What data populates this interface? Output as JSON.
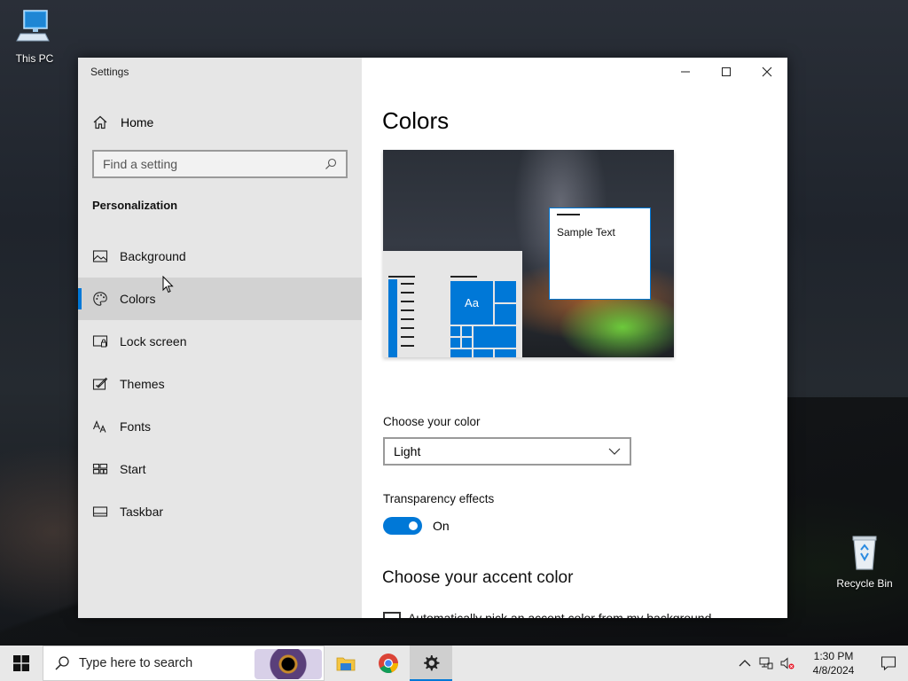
{
  "desktop": {
    "icons": [
      {
        "label": "This PC"
      },
      {
        "label": "Recycle Bin"
      }
    ]
  },
  "window": {
    "title": "Settings"
  },
  "sidebar": {
    "home_label": "Home",
    "search_placeholder": "Find a setting",
    "section_label": "Personalization",
    "items": [
      {
        "label": "Background",
        "icon": "picture-icon",
        "selected": false
      },
      {
        "label": "Colors",
        "icon": "palette-icon",
        "selected": true
      },
      {
        "label": "Lock screen",
        "icon": "lock-screen-icon",
        "selected": false
      },
      {
        "label": "Themes",
        "icon": "themes-brush-icon",
        "selected": false
      },
      {
        "label": "Fonts",
        "icon": "fonts-icon",
        "selected": false
      },
      {
        "label": "Start",
        "icon": "start-tiles-icon",
        "selected": false
      },
      {
        "label": "Taskbar",
        "icon": "taskbar-icon",
        "selected": false
      }
    ]
  },
  "content": {
    "page_title": "Colors",
    "preview": {
      "sample_text": "Sample Text",
      "tile_text": "Aa"
    },
    "choose_color_label": "Choose your color",
    "choose_color_value": "Light",
    "transparency_label": "Transparency effects",
    "transparency_state": "On",
    "accent_title": "Choose your accent color",
    "auto_pick_label": "Automatically pick an accent color from my background"
  },
  "taskbar": {
    "search_placeholder": "Type here to search",
    "time": "1:30 PM",
    "date": "4/8/2024"
  },
  "colors": {
    "accent": "#0078d7",
    "sidebar_bg": "#e6e6e6",
    "selected_bg": "#d2d2d2"
  }
}
